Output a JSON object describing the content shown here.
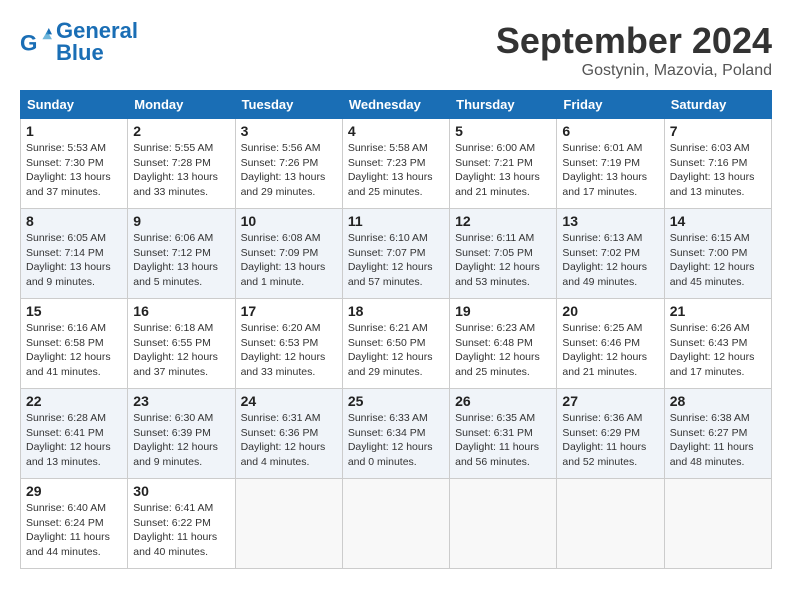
{
  "header": {
    "logo_line1": "General",
    "logo_line2": "Blue",
    "month": "September 2024",
    "location": "Gostynin, Mazovia, Poland"
  },
  "weekdays": [
    "Sunday",
    "Monday",
    "Tuesday",
    "Wednesday",
    "Thursday",
    "Friday",
    "Saturday"
  ],
  "weeks": [
    [
      {
        "day": "1",
        "info": "Sunrise: 5:53 AM\nSunset: 7:30 PM\nDaylight: 13 hours\nand 37 minutes."
      },
      {
        "day": "2",
        "info": "Sunrise: 5:55 AM\nSunset: 7:28 PM\nDaylight: 13 hours\nand 33 minutes."
      },
      {
        "day": "3",
        "info": "Sunrise: 5:56 AM\nSunset: 7:26 PM\nDaylight: 13 hours\nand 29 minutes."
      },
      {
        "day": "4",
        "info": "Sunrise: 5:58 AM\nSunset: 7:23 PM\nDaylight: 13 hours\nand 25 minutes."
      },
      {
        "day": "5",
        "info": "Sunrise: 6:00 AM\nSunset: 7:21 PM\nDaylight: 13 hours\nand 21 minutes."
      },
      {
        "day": "6",
        "info": "Sunrise: 6:01 AM\nSunset: 7:19 PM\nDaylight: 13 hours\nand 17 minutes."
      },
      {
        "day": "7",
        "info": "Sunrise: 6:03 AM\nSunset: 7:16 PM\nDaylight: 13 hours\nand 13 minutes."
      }
    ],
    [
      {
        "day": "8",
        "info": "Sunrise: 6:05 AM\nSunset: 7:14 PM\nDaylight: 13 hours\nand 9 minutes."
      },
      {
        "day": "9",
        "info": "Sunrise: 6:06 AM\nSunset: 7:12 PM\nDaylight: 13 hours\nand 5 minutes."
      },
      {
        "day": "10",
        "info": "Sunrise: 6:08 AM\nSunset: 7:09 PM\nDaylight: 13 hours\nand 1 minute."
      },
      {
        "day": "11",
        "info": "Sunrise: 6:10 AM\nSunset: 7:07 PM\nDaylight: 12 hours\nand 57 minutes."
      },
      {
        "day": "12",
        "info": "Sunrise: 6:11 AM\nSunset: 7:05 PM\nDaylight: 12 hours\nand 53 minutes."
      },
      {
        "day": "13",
        "info": "Sunrise: 6:13 AM\nSunset: 7:02 PM\nDaylight: 12 hours\nand 49 minutes."
      },
      {
        "day": "14",
        "info": "Sunrise: 6:15 AM\nSunset: 7:00 PM\nDaylight: 12 hours\nand 45 minutes."
      }
    ],
    [
      {
        "day": "15",
        "info": "Sunrise: 6:16 AM\nSunset: 6:58 PM\nDaylight: 12 hours\nand 41 minutes."
      },
      {
        "day": "16",
        "info": "Sunrise: 6:18 AM\nSunset: 6:55 PM\nDaylight: 12 hours\nand 37 minutes."
      },
      {
        "day": "17",
        "info": "Sunrise: 6:20 AM\nSunset: 6:53 PM\nDaylight: 12 hours\nand 33 minutes."
      },
      {
        "day": "18",
        "info": "Sunrise: 6:21 AM\nSunset: 6:50 PM\nDaylight: 12 hours\nand 29 minutes."
      },
      {
        "day": "19",
        "info": "Sunrise: 6:23 AM\nSunset: 6:48 PM\nDaylight: 12 hours\nand 25 minutes."
      },
      {
        "day": "20",
        "info": "Sunrise: 6:25 AM\nSunset: 6:46 PM\nDaylight: 12 hours\nand 21 minutes."
      },
      {
        "day": "21",
        "info": "Sunrise: 6:26 AM\nSunset: 6:43 PM\nDaylight: 12 hours\nand 17 minutes."
      }
    ],
    [
      {
        "day": "22",
        "info": "Sunrise: 6:28 AM\nSunset: 6:41 PM\nDaylight: 12 hours\nand 13 minutes."
      },
      {
        "day": "23",
        "info": "Sunrise: 6:30 AM\nSunset: 6:39 PM\nDaylight: 12 hours\nand 9 minutes."
      },
      {
        "day": "24",
        "info": "Sunrise: 6:31 AM\nSunset: 6:36 PM\nDaylight: 12 hours\nand 4 minutes."
      },
      {
        "day": "25",
        "info": "Sunrise: 6:33 AM\nSunset: 6:34 PM\nDaylight: 12 hours\nand 0 minutes."
      },
      {
        "day": "26",
        "info": "Sunrise: 6:35 AM\nSunset: 6:31 PM\nDaylight: 11 hours\nand 56 minutes."
      },
      {
        "day": "27",
        "info": "Sunrise: 6:36 AM\nSunset: 6:29 PM\nDaylight: 11 hours\nand 52 minutes."
      },
      {
        "day": "28",
        "info": "Sunrise: 6:38 AM\nSunset: 6:27 PM\nDaylight: 11 hours\nand 48 minutes."
      }
    ],
    [
      {
        "day": "29",
        "info": "Sunrise: 6:40 AM\nSunset: 6:24 PM\nDaylight: 11 hours\nand 44 minutes."
      },
      {
        "day": "30",
        "info": "Sunrise: 6:41 AM\nSunset: 6:22 PM\nDaylight: 11 hours\nand 40 minutes."
      },
      {
        "day": "",
        "info": ""
      },
      {
        "day": "",
        "info": ""
      },
      {
        "day": "",
        "info": ""
      },
      {
        "day": "",
        "info": ""
      },
      {
        "day": "",
        "info": ""
      }
    ]
  ]
}
